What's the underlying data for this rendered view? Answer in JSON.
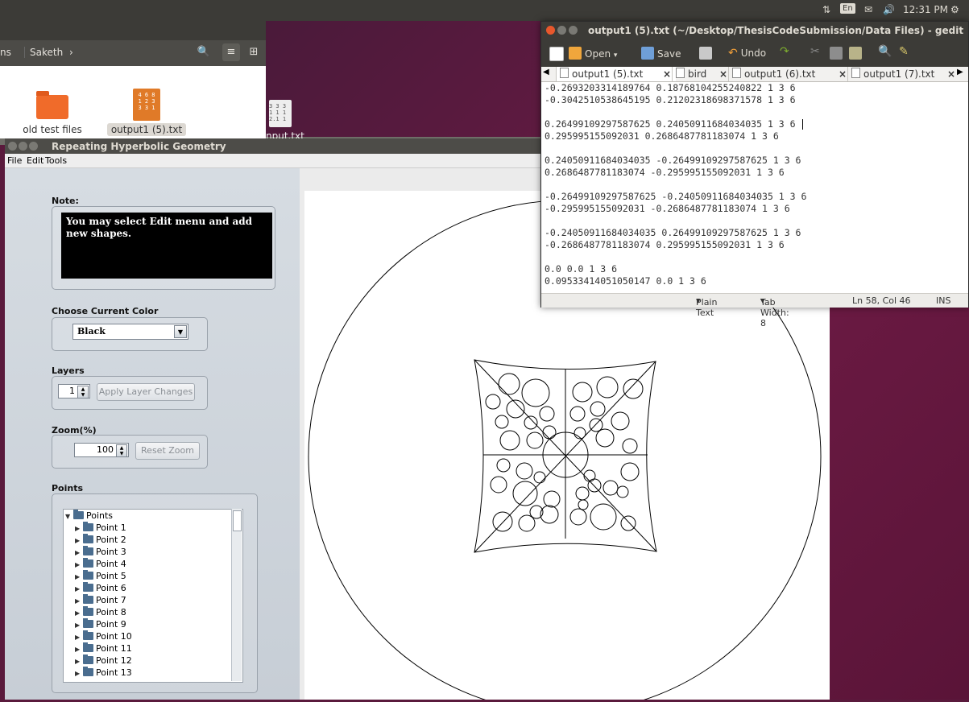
{
  "topbar": {
    "keyboard": "En",
    "time": "12:31 PM"
  },
  "file_manager": {
    "crumb_partial": "ns",
    "crumb_user": "Saketh",
    "files": [
      {
        "name": "old test files",
        "type": "folder"
      },
      {
        "name": "output1 (5).txt",
        "type": "text"
      },
      {
        "name": "nput.txt",
        "type": "text"
      }
    ]
  },
  "app": {
    "title": "Repeating Hyperbolic Geometry",
    "menu": [
      "File",
      "Edit",
      "Tools"
    ],
    "note_label": "Note:",
    "note_text": "You may select Edit menu and add new shapes.",
    "color_label": "Choose Current Color",
    "color_value": "Black",
    "layers_label": "Layers",
    "layers_value": "1",
    "apply_layers_button": "Apply Layer Changes",
    "zoom_label": "Zoom(%)",
    "zoom_value": "100",
    "reset_zoom_button": "Reset Zoom",
    "points_label": "Points",
    "tree_root": "Points",
    "points": [
      "Point 1",
      "Point 2",
      "Point 3",
      "Point 4",
      "Point 5",
      "Point 6",
      "Point 7",
      "Point 8",
      "Point 9",
      "Point 10",
      "Point 11",
      "Point 12",
      "Point 13"
    ]
  },
  "gedit": {
    "title": "output1 (5).txt (~/Desktop/ThesisCodeSubmission/Data Files) - gedit",
    "toolbar": {
      "open": "Open",
      "save": "Save",
      "undo": "Undo"
    },
    "tabs": [
      "output1 (5).txt",
      "bird",
      "output1 (6).txt",
      "output1 (7).txt"
    ],
    "lines": [
      "-0.2693203314189764 0.18768104255240822 1 3 6",
      "-0.3042510538645195 0.21202318698371578 1 3 6",
      "",
      "0.26499109297587625 0.24050911684034035 1 3 6",
      "0.295995155092031 0.2686487781183074 1 3 6",
      "",
      "0.24050911684034035 -0.26499109297587625 1 3 6",
      "0.2686487781183074 -0.295995155092031 1 3 6",
      "",
      "-0.26499109297587625 -0.24050911684034035 1 3 6",
      "-0.295995155092031 -0.2686487781183074 1 3 6",
      "",
      "-0.24050911684034035 0.26499109297587625 1 3 6",
      "-0.2686487781183074 0.295995155092031 1 3 6",
      "",
      "0.0 0.0 1 3 6",
      "0.09533414051050147 0.0 1 3 6"
    ],
    "status": {
      "language": "Plain Text",
      "tab_width": "Tab Width: 8",
      "position": "Ln 58, Col 46",
      "mode": "INS"
    }
  }
}
